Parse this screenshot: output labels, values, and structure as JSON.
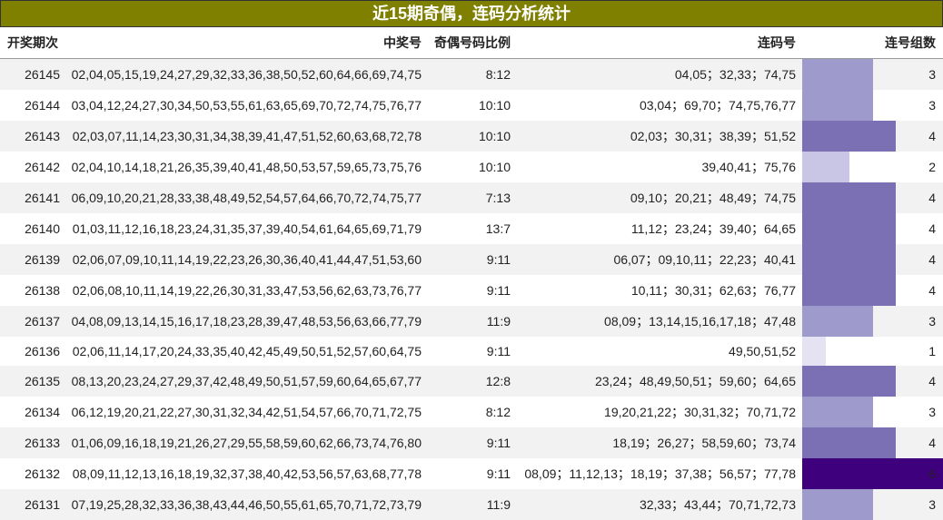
{
  "title": "近15期奇偶，连码分析统计",
  "headers": {
    "issue": "开奖期次",
    "numbers": "中奖号",
    "ratio": "奇偶号码比例",
    "consecutive": "连码号",
    "groups": "连号组数"
  },
  "max_groups": 6,
  "bar_colors": {
    "1": "#e5e3f3",
    "2": "#c8c6e4",
    "3": "#9e9bcc",
    "4": "#7b70b4",
    "6": "#3f007d"
  },
  "rows": [
    {
      "issue": "26145",
      "numbers": "02,04,05,15,19,24,27,29,32,33,36,38,50,52,60,64,66,69,74,75",
      "ratio": "8:12",
      "consecutive": "04,05；32,33；74,75",
      "groups": 3
    },
    {
      "issue": "26144",
      "numbers": "03,04,12,24,27,30,34,50,53,55,61,63,65,69,70,72,74,75,76,77",
      "ratio": "10:10",
      "consecutive": "03,04；69,70；74,75,76,77",
      "groups": 3
    },
    {
      "issue": "26143",
      "numbers": "02,03,07,11,14,23,30,31,34,38,39,41,47,51,52,60,63,68,72,78",
      "ratio": "10:10",
      "consecutive": "02,03；30,31；38,39；51,52",
      "groups": 4
    },
    {
      "issue": "26142",
      "numbers": "02,04,10,14,18,21,26,35,39,40,41,48,50,53,57,59,65,73,75,76",
      "ratio": "10:10",
      "consecutive": "39,40,41；75,76",
      "groups": 2
    },
    {
      "issue": "26141",
      "numbers": "06,09,10,20,21,28,33,38,48,49,52,54,57,64,66,70,72,74,75,77",
      "ratio": "7:13",
      "consecutive": "09,10；20,21；48,49；74,75",
      "groups": 4
    },
    {
      "issue": "26140",
      "numbers": "01,03,11,12,16,18,23,24,31,35,37,39,40,54,61,64,65,69,71,79",
      "ratio": "13:7",
      "consecutive": "11,12；23,24；39,40；64,65",
      "groups": 4
    },
    {
      "issue": "26139",
      "numbers": "02,06,07,09,10,11,14,19,22,23,26,30,36,40,41,44,47,51,53,60",
      "ratio": "9:11",
      "consecutive": "06,07；09,10,11；22,23；40,41",
      "groups": 4
    },
    {
      "issue": "26138",
      "numbers": "02,06,08,10,11,14,19,22,26,30,31,33,47,53,56,62,63,73,76,77",
      "ratio": "9:11",
      "consecutive": "10,11；30,31；62,63；76,77",
      "groups": 4
    },
    {
      "issue": "26137",
      "numbers": "04,08,09,13,14,15,16,17,18,23,28,39,47,48,53,56,63,66,77,79",
      "ratio": "11:9",
      "consecutive": "08,09；13,14,15,16,17,18；47,48",
      "groups": 3
    },
    {
      "issue": "26136",
      "numbers": "02,06,11,14,17,20,24,33,35,40,42,45,49,50,51,52,57,60,64,75",
      "ratio": "9:11",
      "consecutive": "49,50,51,52",
      "groups": 1
    },
    {
      "issue": "26135",
      "numbers": "08,13,20,23,24,27,29,37,42,48,49,50,51,57,59,60,64,65,67,77",
      "ratio": "12:8",
      "consecutive": "23,24；48,49,50,51；59,60；64,65",
      "groups": 4
    },
    {
      "issue": "26134",
      "numbers": "06,12,19,20,21,22,27,30,31,32,34,42,51,54,57,66,70,71,72,75",
      "ratio": "8:12",
      "consecutive": "19,20,21,22；30,31,32；70,71,72",
      "groups": 3
    },
    {
      "issue": "26133",
      "numbers": "01,06,09,16,18,19,21,26,27,29,55,58,59,60,62,66,73,74,76,80",
      "ratio": "9:11",
      "consecutive": "18,19；26,27；58,59,60；73,74",
      "groups": 4
    },
    {
      "issue": "26132",
      "numbers": "08,09,11,12,13,16,18,19,32,37,38,40,42,53,56,57,63,68,77,78",
      "ratio": "9:11",
      "consecutive": "08,09；11,12,13；18,19；37,38；56,57；77,78",
      "groups": 6
    },
    {
      "issue": "26131",
      "numbers": "07,19,25,28,32,33,36,38,43,44,46,50,55,61,65,70,71,72,73,79",
      "ratio": "11:9",
      "consecutive": "32,33；43,44；70,71,72,73",
      "groups": 3
    }
  ]
}
